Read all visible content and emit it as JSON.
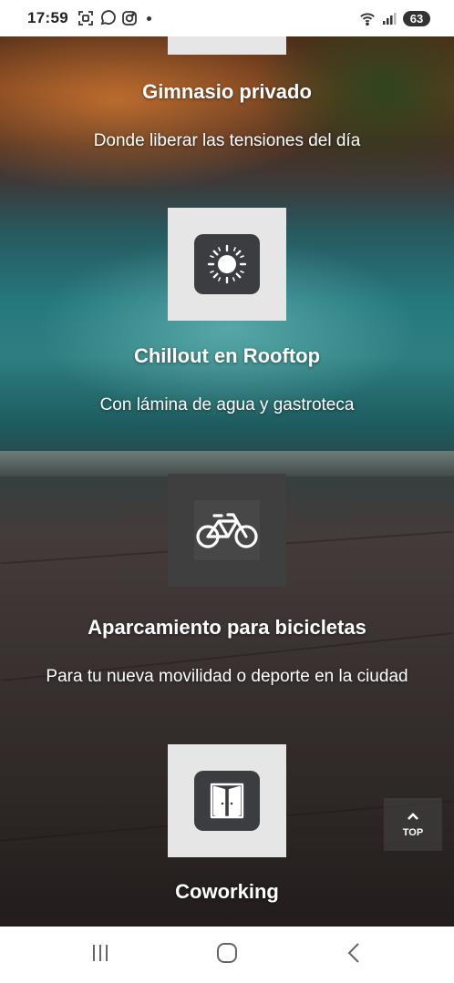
{
  "status_bar": {
    "time": "17:59",
    "battery": "63",
    "icons": [
      "screenshot-icon",
      "whatsapp-icon",
      "instagram-icon",
      "notification-dot",
      "wifi-icon",
      "signal-icon"
    ]
  },
  "features": [
    {
      "title": "Gimnasio privado",
      "subtitle": "Donde liberar las tensiones del día",
      "icon": "dumbbell-icon"
    },
    {
      "title": "Chillout en Rooftop",
      "subtitle": "Con lámina de agua y gastroteca",
      "icon": "sun-icon"
    },
    {
      "title": "Aparcamiento para bicicletas",
      "subtitle": "Para tu nueva movilidad o deporte en la ciudad",
      "icon": "bicycle-icon"
    },
    {
      "title": "Coworking",
      "subtitle": "",
      "icon": "door-icon"
    }
  ],
  "top_button": {
    "label": "TOP"
  },
  "nav": {
    "icons": [
      "recent-apps-icon",
      "home-icon",
      "back-icon"
    ]
  }
}
